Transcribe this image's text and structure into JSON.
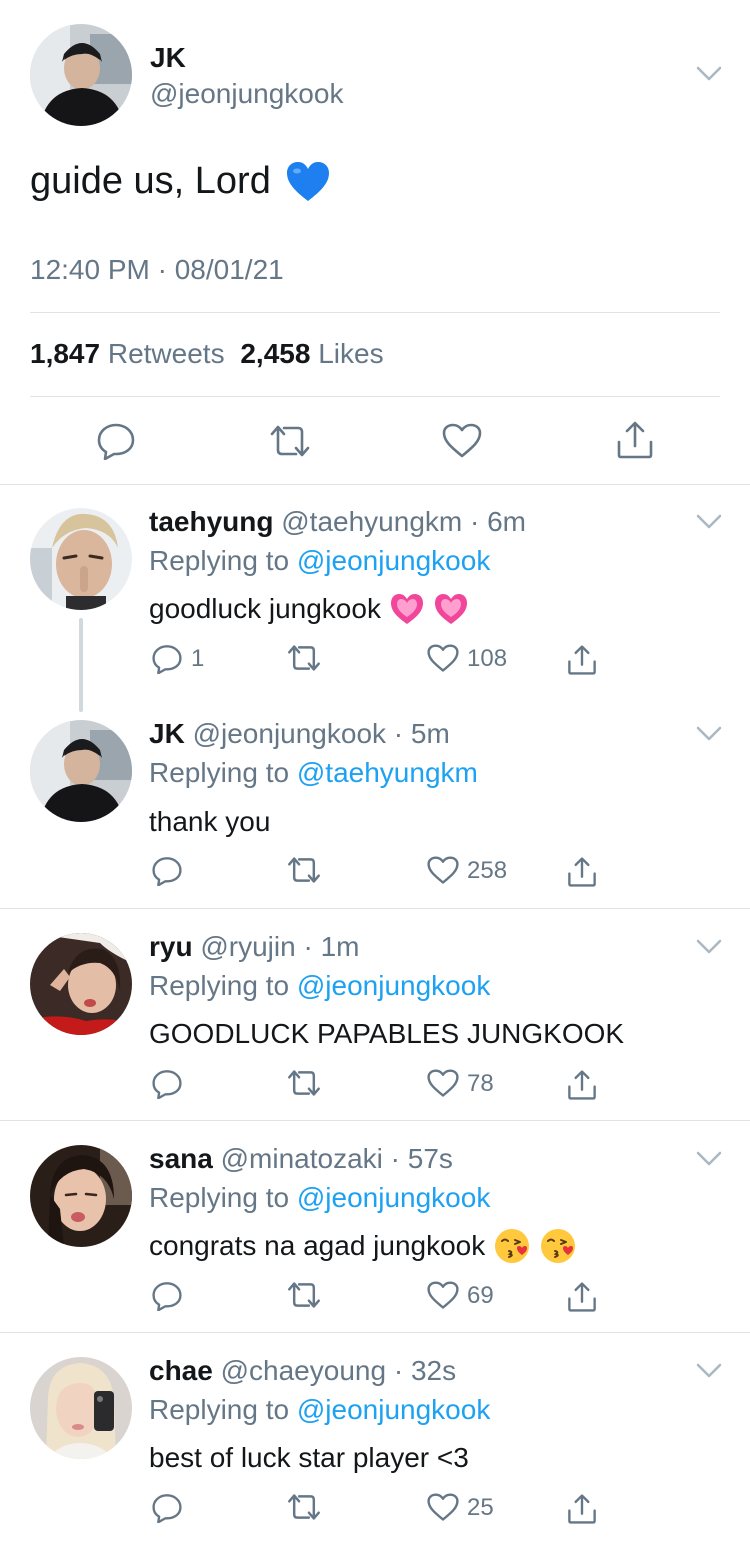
{
  "main": {
    "name": "JK",
    "handle": "@jeonjungkook",
    "text": "guide us, Lord",
    "emoji": "blue-heart",
    "timestamp": "12:40 PM · 08/01/21",
    "retweets_count": "1,847",
    "retweets_label": "Retweets",
    "likes_count": "2,458",
    "likes_label": "Likes"
  },
  "replies": [
    {
      "name": "taehyung",
      "handle": "@taehyungkm",
      "time": "6m",
      "replying_label": "Replying to",
      "replying_to": "@jeonjungkook",
      "text": "goodluck jungkook",
      "emoji": "growing-heart",
      "reply_count": "1",
      "like_count": "108"
    },
    {
      "name": "JK",
      "handle": "@jeonjungkook",
      "time": "5m",
      "replying_label": "Replying to",
      "replying_to": "@taehyungkm",
      "text": "thank you",
      "emoji": "",
      "reply_count": "",
      "like_count": "258"
    },
    {
      "name": "ryu",
      "handle": "@ryujin",
      "time": "1m",
      "replying_label": "Replying to",
      "replying_to": "@jeonjungkook",
      "text": "GOODLUCK PAPABLES JUNGKOOK",
      "emoji": "",
      "reply_count": "",
      "like_count": "78"
    },
    {
      "name": "sana",
      "handle": "@minatozaki",
      "time": "57s",
      "replying_label": "Replying to",
      "replying_to": "@jeonjungkook",
      "text": "congrats na agad jungkook",
      "emoji": "kissing-face",
      "reply_count": "",
      "like_count": "69"
    },
    {
      "name": "chae",
      "handle": "@chaeyoung",
      "time": "32s",
      "replying_label": "Replying to",
      "replying_to": "@jeonjungkook",
      "text": "best of luck star player <3",
      "emoji": "",
      "reply_count": "",
      "like_count": "25"
    }
  ],
  "colors": {
    "text": "#14171a",
    "muted": "#657786",
    "link": "#1da1f2",
    "divider": "#dde3e8"
  }
}
